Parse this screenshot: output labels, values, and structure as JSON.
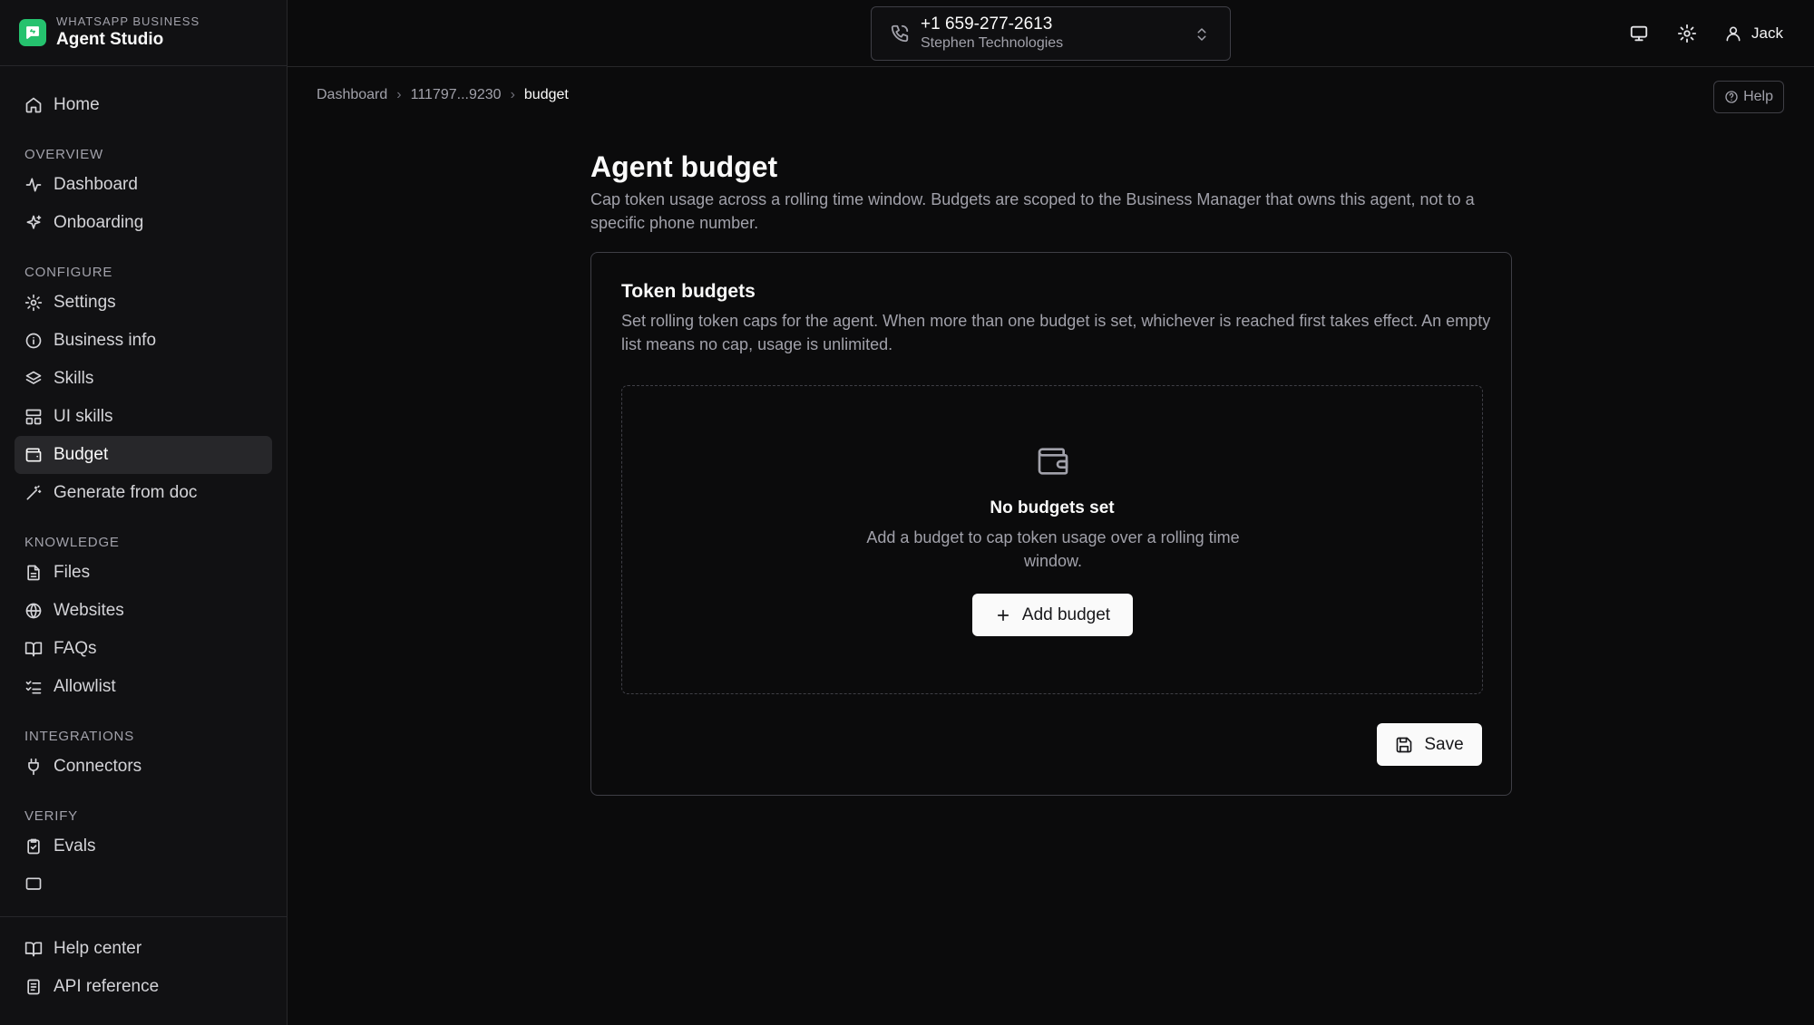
{
  "brand": {
    "kicker": "WHATSAPP BUSINESS",
    "title": "Agent Studio",
    "color": "#25c26e"
  },
  "sidebar": {
    "home": "Home",
    "sections": {
      "overview": "OVERVIEW",
      "configure": "CONFIGURE",
      "knowledge": "KNOWLEDGE",
      "integrations": "INTEGRATIONS",
      "verify": "VERIFY"
    },
    "items": {
      "dashboard": "Dashboard",
      "onboarding": "Onboarding",
      "settings": "Settings",
      "business_info": "Business info",
      "skills": "Skills",
      "ui_skills": "UI skills",
      "budget": "Budget",
      "generate_from_doc": "Generate from doc",
      "files": "Files",
      "websites": "Websites",
      "faqs": "FAQs",
      "allowlist": "Allowlist",
      "connectors": "Connectors",
      "evals": "Evals"
    },
    "active": "budget",
    "bottom": {
      "help_center": "Help center",
      "api_reference": "API reference"
    }
  },
  "topbar": {
    "phone_number": "+1 659-277-2613",
    "organization": "Stephen Technologies",
    "user": "Jack"
  },
  "breadcrumb": [
    "Dashboard",
    "111797...9230",
    "budget"
  ],
  "help_label": "Help",
  "page": {
    "title": "Agent budget",
    "description": "Cap token usage across a rolling time window. Budgets are scoped to the Business Manager that owns this agent, not to a specific phone number."
  },
  "card": {
    "title": "Token budgets",
    "description": "Set rolling token caps for the agent. When more than one budget is set, whichever is reached first takes effect. An empty list means no cap, usage is unlimited.",
    "empty_title": "No budgets set",
    "empty_desc": "Add a budget to cap token usage over a rolling time window.",
    "add_label": "Add budget",
    "save_label": "Save"
  }
}
